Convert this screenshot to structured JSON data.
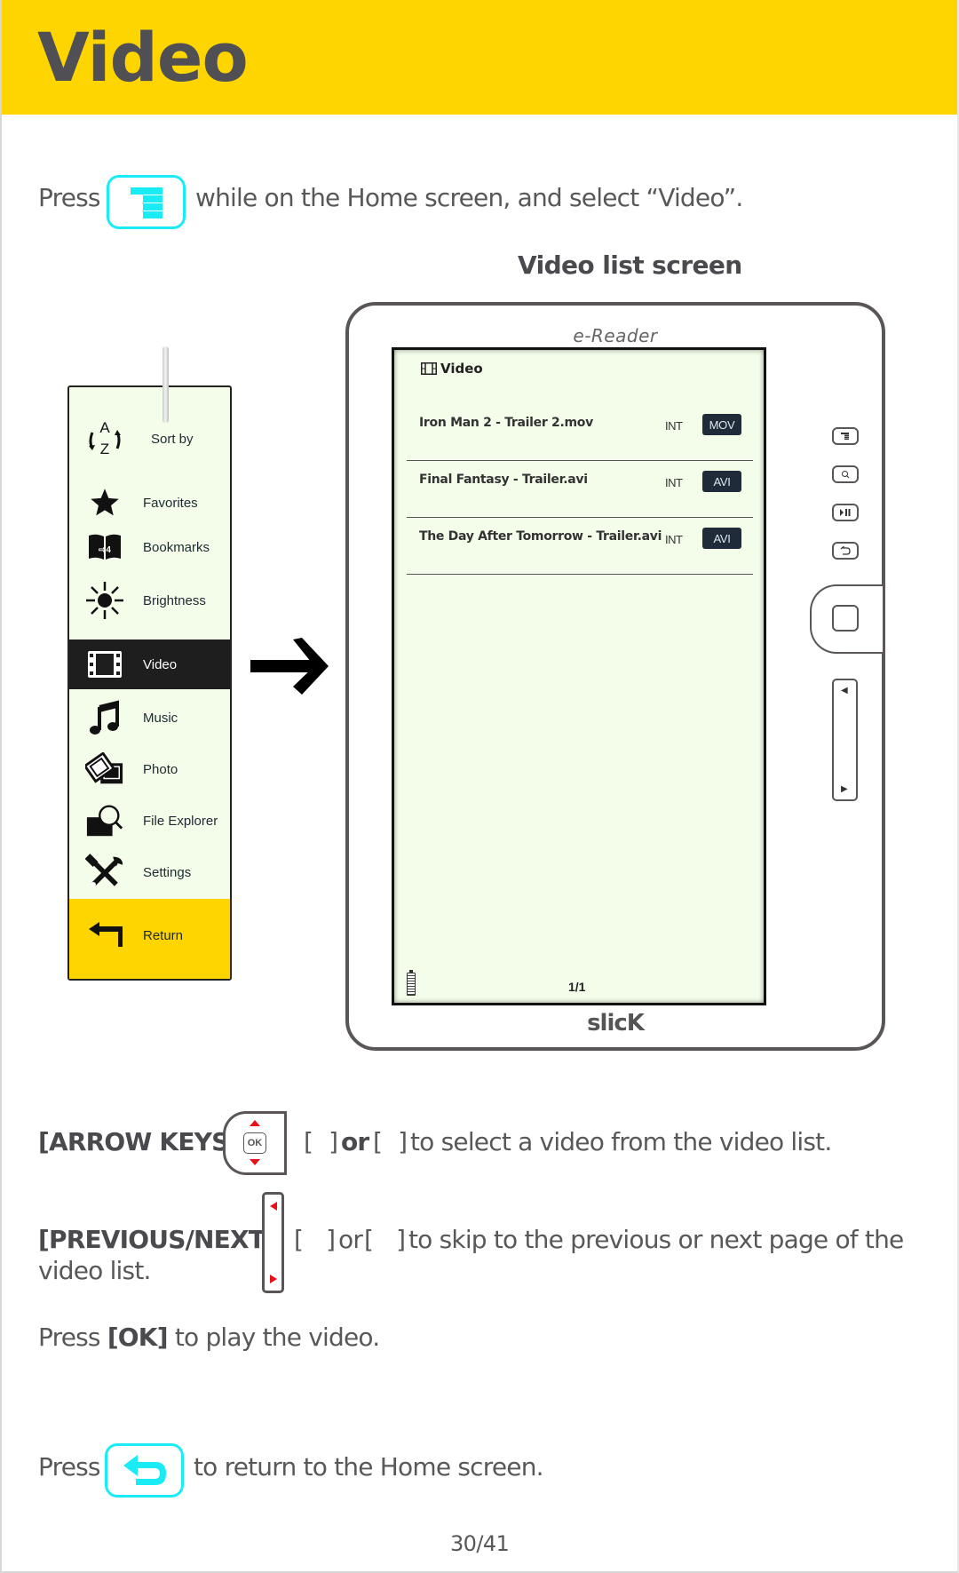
{
  "header": {
    "title": "Video"
  },
  "intro": {
    "press_label": "Press",
    "menu_button_icon": "menu-icon",
    "text": "while on the Home screen, and select “Video”."
  },
  "section_title": "Video list screen",
  "menu": {
    "items": [
      {
        "label": "Sort by",
        "icon": "sort-az-icon"
      },
      {
        "label": "Favorites",
        "icon": "star-icon"
      },
      {
        "label": "Bookmarks",
        "icon": "bookmark-book-icon"
      },
      {
        "label": "Brightness",
        "icon": "sun-icon"
      },
      {
        "label": "Video",
        "icon": "film-icon",
        "active": true
      },
      {
        "label": "Music",
        "icon": "music-note-icon"
      },
      {
        "label": "Photo",
        "icon": "photo-icon"
      },
      {
        "label": "File Explorer",
        "icon": "folder-search-icon"
      },
      {
        "label": "Settings",
        "icon": "tools-icon"
      },
      {
        "label": "Return",
        "icon": "return-arrow-icon"
      }
    ],
    "bookmark_badge": "⇨4"
  },
  "device": {
    "brand_top": "e-Reader",
    "brand_bottom": "slicK",
    "screen": {
      "title": "Video",
      "files": [
        {
          "name": "Iron Man 2 - Trailer 2.mov",
          "location": "INT",
          "type": "MOV"
        },
        {
          "name": "Final Fantasy - Trailer.avi",
          "location": "INT",
          "type": "AVI"
        },
        {
          "name": "The Day After Tomorrow - Trailer.avi",
          "location": "INT",
          "type": "AVI"
        }
      ],
      "page": "1/1"
    },
    "side_buttons": [
      "menu-icon",
      "zoom-icon",
      "play-pause-icon",
      "back-icon"
    ]
  },
  "instructions": {
    "arrow_keys": {
      "label": "[ARROW KEYS]",
      "ok_text": "OK",
      "bracket_open_1": "[",
      "bracket_close_1": "]",
      "or": "or",
      "bracket_open_2": "[",
      "bracket_close_2": "]",
      "text": "to select a video from the video list."
    },
    "prev_next": {
      "label": "[PREVIOUS/NEXT]",
      "bracket_open_1": "[",
      "bracket_close_1": "]",
      "or": "or",
      "bracket_open_2": "[",
      "bracket_close_2": "]",
      "text": "to skip to the previous or next page of the",
      "text_line2": "video list."
    },
    "ok": {
      "prefix": "Press",
      "key": "[OK]",
      "text": "to play the video."
    },
    "return": {
      "prefix": "Press",
      "icon": "back-icon",
      "text": "to return to the Home screen."
    }
  },
  "footer": {
    "page": "30/41"
  }
}
